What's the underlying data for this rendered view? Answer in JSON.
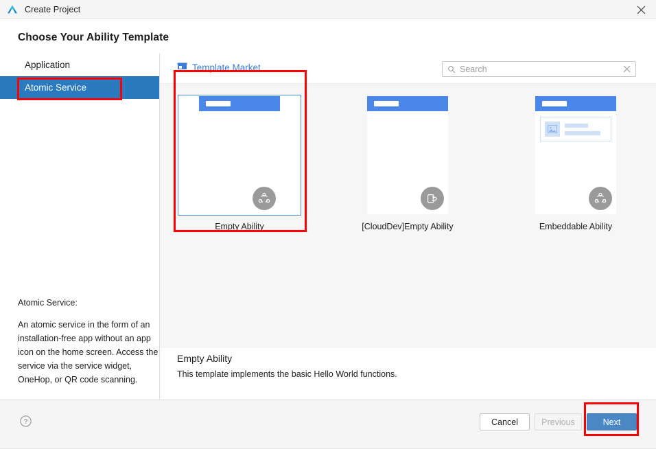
{
  "window": {
    "title": "Create Project",
    "logo_icon": "deveco-triangle-logo",
    "close_icon": "close-icon"
  },
  "heading": "Choose Your Ability Template",
  "sidebar": {
    "items": [
      {
        "label": "Application",
        "selected": false
      },
      {
        "label": "Atomic Service",
        "selected": true
      }
    ],
    "description": {
      "title": "Atomic Service:",
      "body": "An atomic service in the form of an installation-free app without an app icon on the home screen. Access the service via the service widget, OneHop, or QR code scanning."
    }
  },
  "content": {
    "market_link": {
      "label": "Template Market",
      "icon": "store-icon",
      "color": "#3b7dd8"
    },
    "search": {
      "placeholder": "Search",
      "value": "",
      "search_icon": "search-icon",
      "clear_icon": "clear-icon"
    },
    "templates": [
      {
        "label": "Empty Ability",
        "selected": true,
        "badge_icon": "atomic-service-icon",
        "preview": "blank"
      },
      {
        "label": "[CloudDev]Empty Ability",
        "selected": false,
        "badge_icon": "cloud-device-icon",
        "preview": "blank"
      },
      {
        "label": "Embeddable Ability",
        "selected": false,
        "badge_icon": "atomic-service-icon",
        "preview": "card"
      }
    ],
    "detail": {
      "title": "Empty Ability",
      "description": "This template implements the basic Hello World functions."
    }
  },
  "footer": {
    "help_icon": "help-icon",
    "cancel_label": "Cancel",
    "previous_label": "Previous",
    "next_label": "Next"
  },
  "colors": {
    "accent_blue": "#2a7ac0",
    "primary_button": "#4a87c4",
    "link_blue": "#3b7dd8",
    "annotation_red": "#ff0000"
  }
}
